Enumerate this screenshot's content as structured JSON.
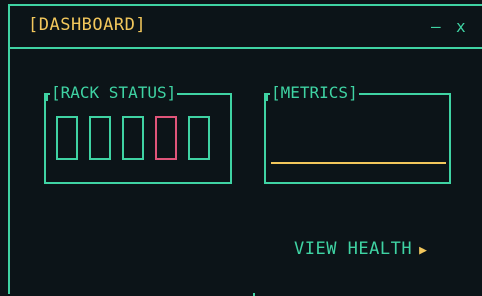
{
  "window": {
    "title": "[DASHBOARD]",
    "controls": {
      "minimize": "—",
      "close": "x"
    }
  },
  "rack_status": {
    "label": "[RACK STATUS]",
    "racks": [
      {
        "state": "ok"
      },
      {
        "state": "ok"
      },
      {
        "state": "ok"
      },
      {
        "state": "alert"
      },
      {
        "state": "ok"
      }
    ]
  },
  "metrics": {
    "label": "[METRICS]"
  },
  "action": {
    "label": "VIEW HEALTH",
    "arrow": "▶"
  },
  "colors": {
    "accent": "#3fd3a3",
    "highlight": "#f2c75c",
    "alert": "#e0557a",
    "background": "#0c1418"
  }
}
